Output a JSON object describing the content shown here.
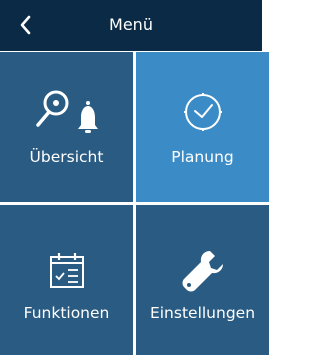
{
  "header": {
    "title": "Menü",
    "back_icon": "chevron-left-icon"
  },
  "tiles": [
    {
      "label": "Übersicht",
      "icon": "search-bell-icon",
      "active": false
    },
    {
      "label": "Planung",
      "icon": "clock-icon",
      "active": true
    },
    {
      "label": "Funktionen",
      "icon": "calendar-checklist-icon",
      "active": false
    },
    {
      "label": "Einstellungen",
      "icon": "wrench-icon",
      "active": false
    }
  ],
  "colors": {
    "header_bg": "#0a2a46",
    "tile_bg": "#2a5b82",
    "tile_active_bg": "#3b8cc6",
    "text": "#ffffff"
  }
}
